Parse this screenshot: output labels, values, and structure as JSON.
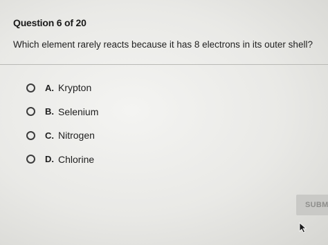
{
  "quiz": {
    "header": "Question 6 of 20",
    "question": "Which element rarely reacts because it has 8 electrons in its outer shell?",
    "options": [
      {
        "letter": "A.",
        "text": "Krypton"
      },
      {
        "letter": "B.",
        "text": "Selenium"
      },
      {
        "letter": "C.",
        "text": "Nitrogen"
      },
      {
        "letter": "D.",
        "text": "Chlorine"
      }
    ],
    "submit_label": "SUBM"
  },
  "icons": {
    "pointer": "mouse-pointer-icon"
  }
}
